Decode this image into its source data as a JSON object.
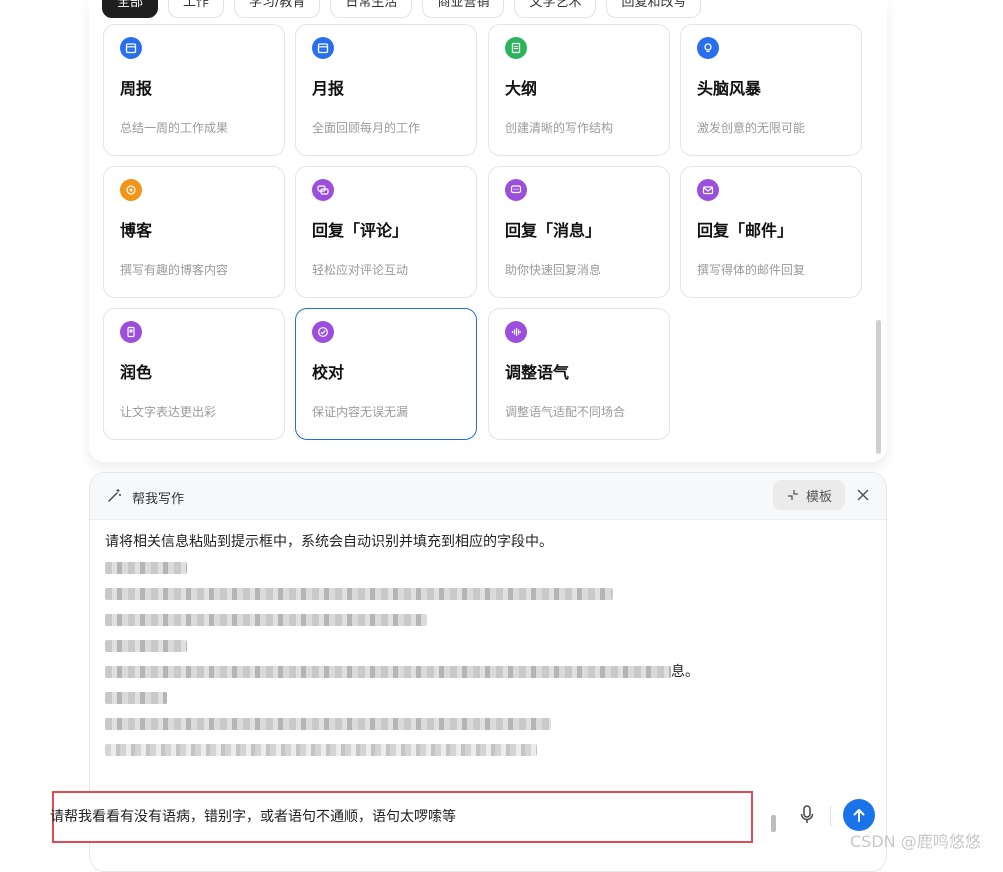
{
  "categories": [
    {
      "label": "全部",
      "active": true
    },
    {
      "label": "工作"
    },
    {
      "label": "学习/教育"
    },
    {
      "label": "日常生活"
    },
    {
      "label": "商业营销"
    },
    {
      "label": "文学艺术"
    },
    {
      "label": "回复和改写"
    }
  ],
  "cards": [
    {
      "title": "周报",
      "desc": "总结一周的工作成果",
      "icon": "calendar-icon",
      "color": "#2a6ef0"
    },
    {
      "title": "月报",
      "desc": "全面回顾每月的工作",
      "icon": "calendar-icon",
      "color": "#2a6ef0"
    },
    {
      "title": "大纲",
      "desc": "创建清晰的写作结构",
      "icon": "document-icon",
      "color": "#2bb45a"
    },
    {
      "title": "头脑风暴",
      "desc": "激发创意的无限可能",
      "icon": "lightbulb-icon",
      "color": "#2a6ef0"
    },
    {
      "title": "博客",
      "desc": "撰写有趣的博客内容",
      "icon": "broadcast-icon",
      "color": "#f29418"
    },
    {
      "title": "回复「评论」",
      "desc": "轻松应对评论互动",
      "icon": "chat-bubbles-icon",
      "color": "#9b4fdc"
    },
    {
      "title": "回复「消息」",
      "desc": "助你快速回复消息",
      "icon": "message-icon",
      "color": "#9b4fdc"
    },
    {
      "title": "回复「邮件」",
      "desc": "撰写得体的邮件回复",
      "icon": "envelope-icon",
      "color": "#9b4fdc"
    },
    {
      "title": "润色",
      "desc": "让文字表达更出彩",
      "icon": "polish-icon",
      "color": "#9b4fdc"
    },
    {
      "title": "校对",
      "desc": "保证内容无误无漏",
      "icon": "check-badge-icon",
      "color": "#9b4fdc",
      "selected": true
    },
    {
      "title": "调整语气",
      "desc": "调整语气适配不同场合",
      "icon": "sound-wave-icon",
      "color": "#9b4fdc"
    }
  ],
  "write_panel": {
    "title": "帮我写作",
    "template_button": "模板",
    "intro": "请将相关信息粘贴到提示框中，系统会自动识别并填充到相应的字段中。",
    "partial_tail": "息。"
  },
  "input": {
    "text": "请帮我看看有没有语病，错别字，或者语句不通顺，语句太啰嗦等"
  },
  "watermark": "CSDN @鹿鸣悠悠",
  "colors": {
    "accent": "#1a73e8",
    "highlight_border": "#e24a55",
    "selected_border": "#1f6fd6"
  }
}
